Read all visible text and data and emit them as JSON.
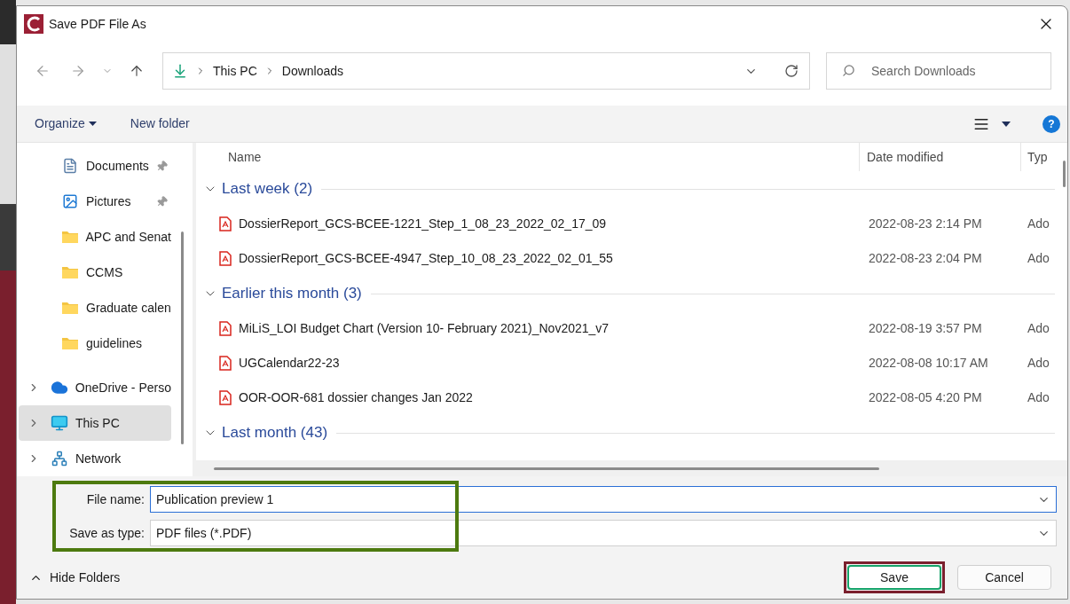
{
  "window": {
    "title": "Save PDF File As"
  },
  "address_bar": {
    "path": [
      "This PC",
      "Downloads"
    ]
  },
  "search": {
    "placeholder": "Search Downloads"
  },
  "toolbar": {
    "organize": "Organize",
    "new_folder": "New folder"
  },
  "sidebar": {
    "items": [
      {
        "label": "Documents",
        "kind": "documents",
        "pinned": true,
        "selected": false,
        "expandable": false
      },
      {
        "label": "Pictures",
        "kind": "pictures",
        "pinned": true,
        "selected": false,
        "expandable": false
      },
      {
        "label": "APC and Senat",
        "kind": "folder",
        "pinned": false,
        "selected": false,
        "expandable": false
      },
      {
        "label": "CCMS",
        "kind": "folder",
        "pinned": false,
        "selected": false,
        "expandable": false
      },
      {
        "label": "Graduate calen",
        "kind": "folder",
        "pinned": false,
        "selected": false,
        "expandable": false
      },
      {
        "label": "guidelines",
        "kind": "folder",
        "pinned": false,
        "selected": false,
        "expandable": false
      },
      {
        "label": "OneDrive - Perso",
        "kind": "cloud",
        "pinned": false,
        "selected": false,
        "expandable": true
      },
      {
        "label": "This PC",
        "kind": "pc",
        "pinned": false,
        "selected": true,
        "expandable": true
      },
      {
        "label": "Network",
        "kind": "network",
        "pinned": false,
        "selected": false,
        "expandable": true
      }
    ]
  },
  "columns": [
    "Name",
    "Date modified",
    "Typ"
  ],
  "groups": [
    {
      "label": "Last week (2)",
      "expanded": true,
      "files": [
        {
          "name": "DossierReport_GCS-BCEE-1221_Step_1_08_23_2022_02_17_09",
          "date": "2022-08-23 2:14 PM",
          "type": "Ado"
        },
        {
          "name": "DossierReport_GCS-BCEE-4947_Step_10_08_23_2022_02_01_55",
          "date": "2022-08-23 2:04 PM",
          "type": "Ado"
        }
      ]
    },
    {
      "label": "Earlier this month (3)",
      "expanded": true,
      "files": [
        {
          "name": "MiLiS_LOI Budget Chart (Version 10- February 2021)_Nov2021_v7",
          "date": "2022-08-19 3:57 PM",
          "type": "Ado"
        },
        {
          "name": "UGCalendar22-23",
          "date": "2022-08-08 10:17 AM",
          "type": "Ado"
        },
        {
          "name": "OOR-OOR-681 dossier changes Jan 2022",
          "date": "2022-08-05 4:20 PM",
          "type": "Ado"
        }
      ]
    },
    {
      "label": "Last month (43)",
      "expanded": true
    }
  ],
  "help": "?",
  "file_name": {
    "label": "File name:",
    "value": "Publication preview 1"
  },
  "save_type": {
    "label": "Save as type:",
    "value": "PDF files (*.PDF)"
  },
  "form_highlighted": true,
  "hide_folders": "Hide Folders",
  "buttons": [
    {
      "label": "Save",
      "kind": "primary",
      "highlighted": true
    },
    {
      "label": "Cancel",
      "kind": "secondary",
      "highlighted": false
    }
  ]
}
